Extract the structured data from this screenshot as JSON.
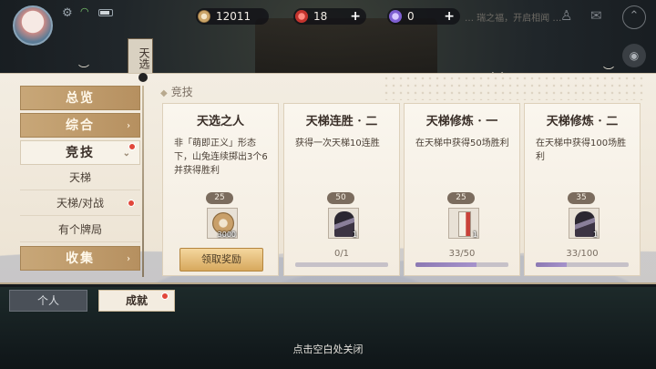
{
  "topbar": {
    "coins": "12011",
    "tickets": "18",
    "jade": "0",
    "scroll_text": "… 瑞之福，开启相闻 …"
  },
  "sign": "天选",
  "panel": {
    "section_title": "竞技"
  },
  "nav": {
    "items": [
      {
        "label": "总览",
        "kind": "main"
      },
      {
        "label": "综合",
        "kind": "main"
      },
      {
        "label": "竞技",
        "kind": "active"
      },
      {
        "label": "天梯",
        "kind": "sub"
      },
      {
        "label": "天梯/对战",
        "kind": "sub"
      },
      {
        "label": "有个牌局",
        "kind": "sub"
      },
      {
        "label": "收集",
        "kind": "main"
      }
    ]
  },
  "cards": [
    {
      "title": "天选之人",
      "desc": "非「萌即正义」形态下，山兔连续掷出3个6并获得胜利",
      "reward_count": "25",
      "reward_qty": "3000",
      "button": "领取奖励"
    },
    {
      "title": "天梯连胜 · 二",
      "desc": "获得一次天梯10连胜",
      "reward_count": "50",
      "reward_qty": "1",
      "progress_text": "0/1",
      "progress": 0
    },
    {
      "title": "天梯修炼 · 一",
      "desc": "在天梯中获得50场胜利",
      "reward_count": "25",
      "reward_qty": "1",
      "progress_text": "33/50",
      "progress": 0.66
    },
    {
      "title": "天梯修炼 · 二",
      "desc": "在天梯中获得100场胜利",
      "reward_count": "35",
      "reward_qty": "1",
      "progress_text": "33/100",
      "progress": 0.33
    }
  ],
  "tabs": {
    "personal": "个人",
    "achievement": "成就"
  },
  "close_hint": "点击空白处关闭",
  "colors": {
    "accent_gold": "#c8a778",
    "progress_purple": "#8c79b3",
    "badge_red": "#e1473a"
  }
}
